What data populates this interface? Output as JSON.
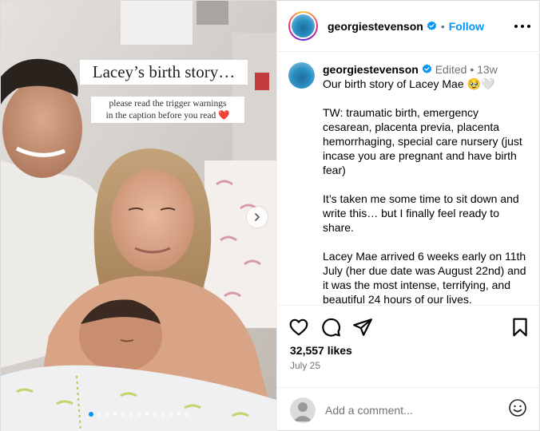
{
  "media": {
    "overlay_title": "Lacey’s birth story…",
    "overlay_subtitle_line1": "please read the trigger warnings",
    "overlay_subtitle_line2": "in the caption before you read ❤️",
    "slide_count": 13,
    "active_slide": 1
  },
  "header": {
    "username": "georgiestevenson",
    "separator": "•",
    "follow_label": "Follow"
  },
  "caption": {
    "username": "georgiestevenson",
    "edited": "Edited",
    "separator": "•",
    "age": "13w",
    "first_line": "Our birth story of Lacey Mae 🥹🤍",
    "paragraphs": [
      "TW: traumatic birth, emergency cesarean, placenta previa, placenta hemorrhaging, special care nursery (just incase you are pregnant and have birth fear)",
      "It’s taken me some time to sit down and write this… but I finally feel ready to share.",
      "Lacey Mae arrived 6 weeks early on 11th July (her due date was August 22nd) and it was the most intense, terrifying, and beautiful 24 hours of our lives."
    ]
  },
  "engagement": {
    "likes": "32,557 likes",
    "date": "July 25"
  },
  "comment": {
    "placeholder": "Add a comment..."
  },
  "icons": {
    "verified": "verified-badge-icon",
    "like": "heart-icon",
    "comment": "comment-icon",
    "share": "share-icon",
    "save": "bookmark-icon",
    "emoji": "emoji-icon",
    "more": "more-options-icon",
    "next": "chevron-right-icon"
  },
  "colors": {
    "accent": "#0095f6",
    "muted": "#737373",
    "border": "#efefef"
  }
}
